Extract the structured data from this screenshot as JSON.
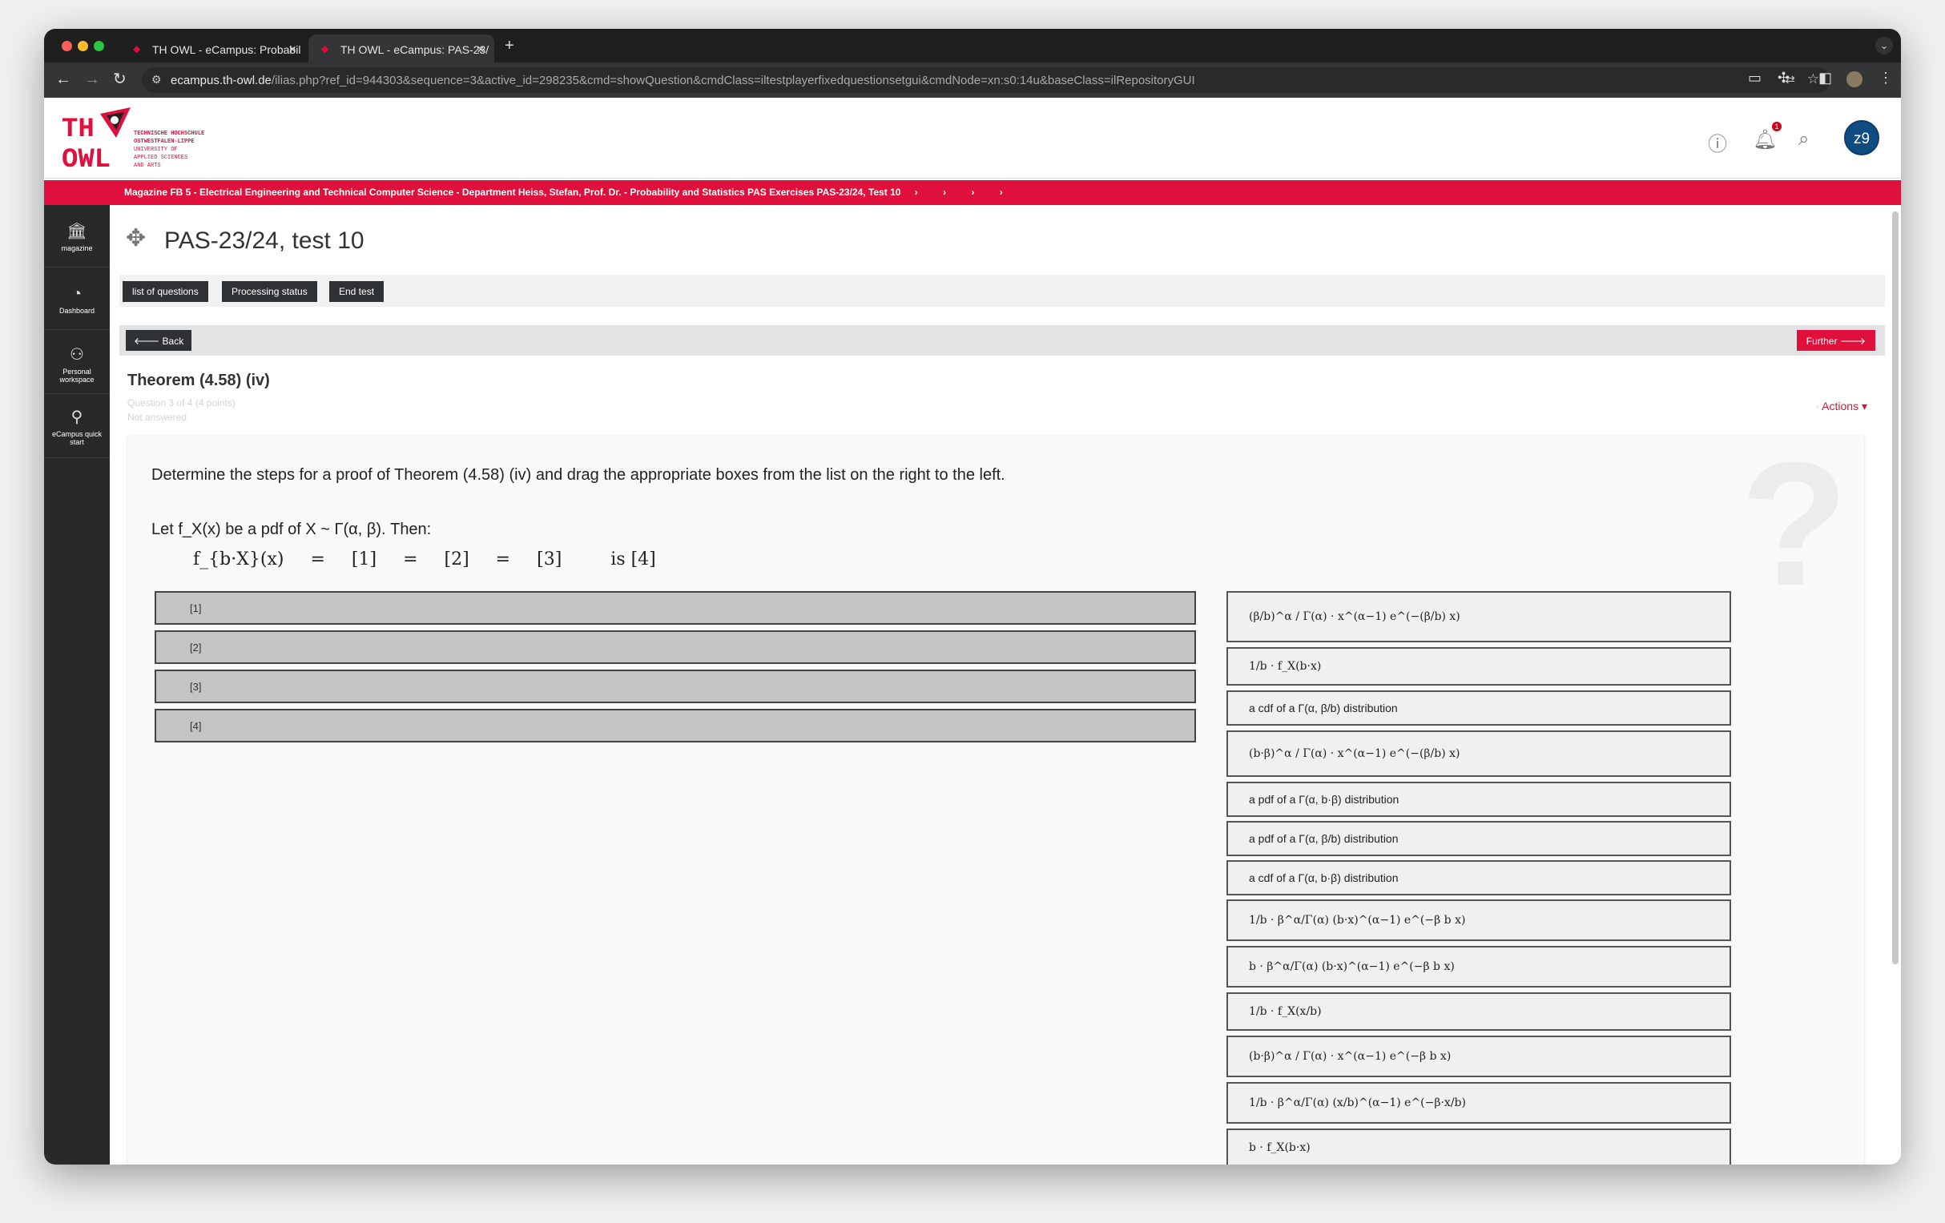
{
  "browser": {
    "tabs": [
      {
        "title": "TH OWL - eCampus: Probabil",
        "active": false
      },
      {
        "title": "TH OWL - eCampus: PAS-23/",
        "active": true
      }
    ],
    "url_host": "ecampus.th-owl.de",
    "url_path": "/ilias.php?ref_id=944303&sequence=3&active_id=298235&cmd=showQuestion&cmdClass=iltestplayerfixedquestionsetgui&cmdNode=xn:s0:14u&baseClass=ilRepositoryGUI"
  },
  "logo": {
    "mark": "TH OWL",
    "lines": [
      "TECHNISCHE HOCHSCHULE",
      "OSTWESTFALEN-LIPPE",
      "UNIVERSITY OF",
      "APPLIED SCIENCES",
      "AND ARTS"
    ]
  },
  "header": {
    "notification_count": "1",
    "avatar_initials": "z9"
  },
  "breadcrumb": "Magazine FB 5 - Electrical Engineering and Technical Computer Science - Department Heiss, Stefan, Prof. Dr. - Probability and Statistics PAS Exercises PAS-23/24, Test 10",
  "sidebar": [
    {
      "label": "magazine",
      "icon": "bank-icon"
    },
    {
      "label": "Dashboard",
      "icon": "dashboard-icon"
    },
    {
      "label": "Personal workspace",
      "icon": "person-icon"
    },
    {
      "label": "eCampus quick start",
      "icon": "link-icon"
    }
  ],
  "page": {
    "title": "PAS-23/24, test 10",
    "buttons": {
      "list": "list of questions",
      "status": "Processing status",
      "end": "End test"
    },
    "back": "Back",
    "further": "Further"
  },
  "question": {
    "title": "Theorem (4.58) (iv)",
    "meta": "Question 3 of 4 (4 points)",
    "status": "Not answered",
    "actions": "Actions",
    "text": "Determine the steps for a proof of Theorem (4.58) (iv) and drag the appropriate boxes from the list on the right to the left.",
    "let_line": "Let f_X(x) be a pdf of X ~ Γ(α, β). Then:",
    "equation": [
      "f_{b·X}(x)",
      "=",
      "[1]",
      "=",
      "[2]",
      "=",
      "[3]",
      "is [4]"
    ],
    "targets": [
      "[1]",
      "[2]",
      "[3]",
      "[4]"
    ],
    "sources": [
      "(β/b)^α / Γ(α) · x^(α−1) e^(−(β/b) x)",
      "1/b · f_X(b·x)",
      "a cdf of a Γ(α, β/b) distribution",
      "(b·β)^α / Γ(α) · x^(α−1) e^(−(β/b) x)",
      "a pdf of a Γ(α, b·β) distribution",
      "a pdf of a Γ(α, β/b) distribution",
      "a cdf of a Γ(α, b·β) distribution",
      "1/b · β^α/Γ(α) (b·x)^(α−1) e^(−β b x)",
      "b · β^α/Γ(α) (b·x)^(α−1) e^(−β b x)",
      "1/b · f_X(x/b)",
      "(b·β)^α / Γ(α) · x^(α−1) e^(−β b x)",
      "1/b · β^α/Γ(α) (x/b)^(α−1) e^(−β·x/b)",
      "b · f_X(b·x)"
    ]
  },
  "colors": {
    "brand": "#e0103d",
    "dark": "#2f3235",
    "sidebar": "#27292b"
  }
}
